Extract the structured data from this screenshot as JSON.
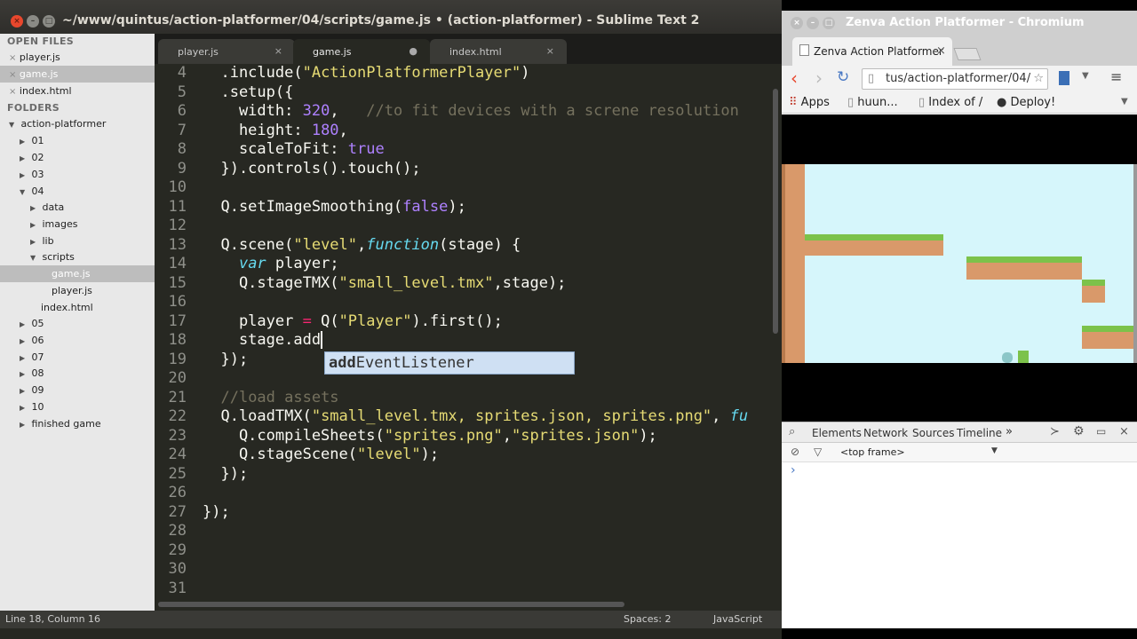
{
  "sublime": {
    "title": "~/www/quintus/action-platformer/04/scripts/game.js • (action-platformer) - Sublime Text 2",
    "open_files_header": "OPEN FILES",
    "open_files": [
      "player.js",
      "game.js",
      "index.html"
    ],
    "folders_header": "FOLDERS",
    "folder_root": "action-platformer",
    "tree": [
      "01",
      "02",
      "03",
      "04",
      "data",
      "images",
      "lib",
      "scripts",
      "game.js",
      "player.js",
      "index.html",
      "05",
      "06",
      "07",
      "08",
      "09",
      "10",
      "finished game"
    ],
    "tabs": [
      {
        "label": "player.js",
        "close": "×"
      },
      {
        "label": "game.js",
        "close": "●"
      },
      {
        "label": "index.html",
        "close": "×"
      }
    ],
    "line_numbers": [
      "4",
      "5",
      "6",
      "7",
      "8",
      "9",
      "10",
      "11",
      "12",
      "13",
      "14",
      "15",
      "16",
      "17",
      "18",
      "19",
      "20",
      "21",
      "22",
      "23",
      "24",
      "25",
      "26",
      "27",
      "28",
      "29",
      "30",
      "31"
    ],
    "autocomplete": {
      "match": "add",
      "rest": "EventListener"
    },
    "status": {
      "position": "Line 18, Column 16",
      "indent": "Spaces: 2",
      "syntax": "JavaScript"
    }
  },
  "chromium": {
    "title": "Zenva Action Platformer - Chromium",
    "tab_label": "Zenva Action Platformer",
    "tab_close": "×",
    "url": "tus/action-platformer/04/",
    "bookmarks": [
      "Apps",
      "huun...",
      "Index of /",
      "Deploy!"
    ],
    "devtools_tabs": [
      "Elements",
      "Network",
      "Sources",
      "Timeline"
    ],
    "frame_select": "<top frame>",
    "console_prompt": "›"
  },
  "colors": {
    "accent_red": "#e8472d",
    "game_sky": "#d6f6fb",
    "grass": "#7cc24a",
    "dirt": "#d9996a"
  }
}
